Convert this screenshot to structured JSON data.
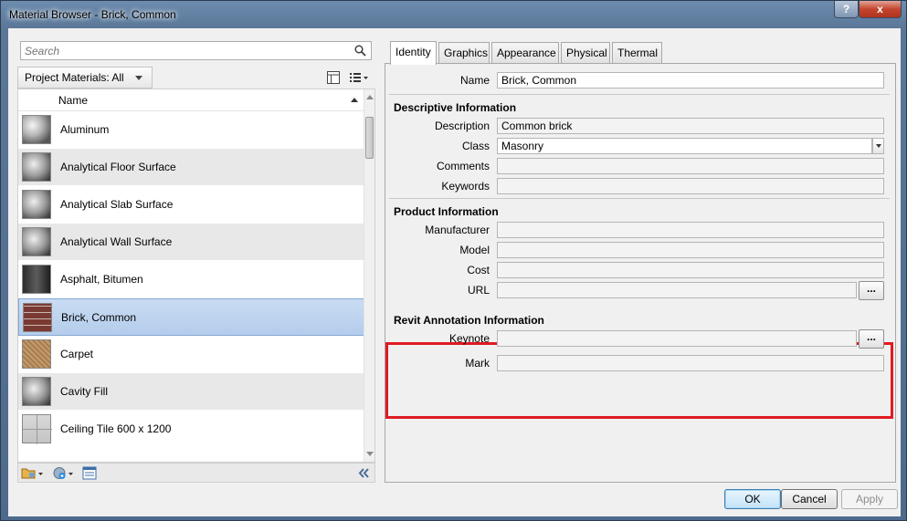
{
  "window": {
    "title": "Material Browser - Brick, Common",
    "help_label": "?",
    "close_label": "x"
  },
  "search": {
    "placeholder": "Search"
  },
  "filter": {
    "label": "Project Materials: All"
  },
  "list": {
    "column": "Name",
    "items": [
      {
        "label": "Aluminum",
        "thumb": "sphere"
      },
      {
        "label": "Analytical Floor Surface",
        "thumb": "analytic"
      },
      {
        "label": "Analytical Slab Surface",
        "thumb": "analytic"
      },
      {
        "label": "Analytical Wall Surface",
        "thumb": "analytic"
      },
      {
        "label": "Asphalt, Bitumen",
        "thumb": "asphalt"
      },
      {
        "label": "Brick, Common",
        "thumb": "brick",
        "selected": true
      },
      {
        "label": "Carpet",
        "thumb": "carpet"
      },
      {
        "label": "Cavity Fill",
        "thumb": "analytic"
      },
      {
        "label": "Ceiling Tile 600 x 1200",
        "thumb": "ceiling"
      }
    ]
  },
  "tabs": [
    "Identity",
    "Graphics",
    "Appearance",
    "Physical",
    "Thermal"
  ],
  "identity": {
    "name_label": "Name",
    "name_value": "Brick, Common",
    "descriptive": {
      "title": "Descriptive Information",
      "description_label": "Description",
      "description_value": "Common brick",
      "class_label": "Class",
      "class_value": "Masonry",
      "comments_label": "Comments",
      "comments_value": "",
      "keywords_label": "Keywords",
      "keywords_value": ""
    },
    "product": {
      "title": "Product Information",
      "manufacturer_label": "Manufacturer",
      "model_label": "Model",
      "cost_label": "Cost",
      "url_label": "URL",
      "browse_label": "..."
    },
    "annotation": {
      "title": "Revit Annotation Information",
      "keynote_label": "Keynote",
      "mark_label": "Mark",
      "browse_label": "..."
    }
  },
  "footer": {
    "ok": "OK",
    "cancel": "Cancel",
    "apply": "Apply"
  },
  "colors": {
    "highlight": "#e01a22",
    "selection": "#b4cdeb"
  }
}
